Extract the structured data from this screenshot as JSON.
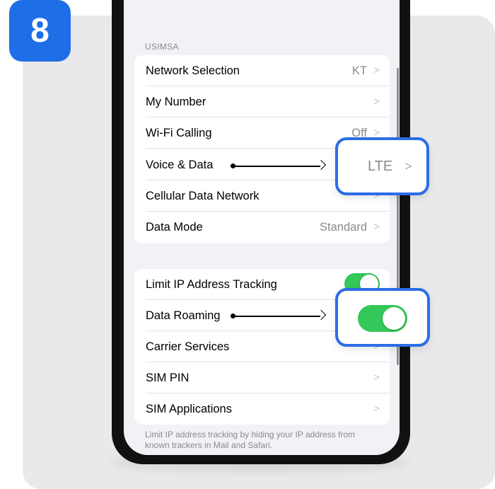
{
  "step_number": "8",
  "section_header": "USIMSA",
  "group1": {
    "rows": [
      {
        "label": "Network Selection",
        "value": "KT",
        "chevron": ">"
      },
      {
        "label": "My Number",
        "value": "",
        "chevron": ">"
      },
      {
        "label": "Wi-Fi Calling",
        "value": "Off",
        "chevron": ">"
      },
      {
        "label": "Voice & Data",
        "value": "",
        "chevron": ""
      },
      {
        "label": "Cellular Data Network",
        "value": "",
        "chevron": ">"
      },
      {
        "label": "Data Mode",
        "value": "Standard",
        "chevron": ">"
      }
    ]
  },
  "group2": {
    "rows": [
      {
        "label": "Limit IP Address Tracking",
        "toggle_on": true
      },
      {
        "label": "Data Roaming",
        "toggle_on": true
      },
      {
        "label": "Carrier Services",
        "chevron": ">"
      },
      {
        "label": "SIM PIN",
        "chevron": ">"
      },
      {
        "label": "SIM Applications",
        "chevron": ">"
      }
    ]
  },
  "footer_text": "Limit IP address tracking by hiding your IP address from known trackers in Mail and Safari.",
  "callouts": {
    "voice_data_value": "LTE",
    "voice_data_chevron": ">",
    "data_roaming_toggle_on": true
  },
  "colors": {
    "badge": "#1e6ee8",
    "callout_border": "#2b6de6",
    "toggle_on": "#34c759"
  },
  "icons": [
    "chevron-right-icon",
    "arrow-right-icon"
  ]
}
